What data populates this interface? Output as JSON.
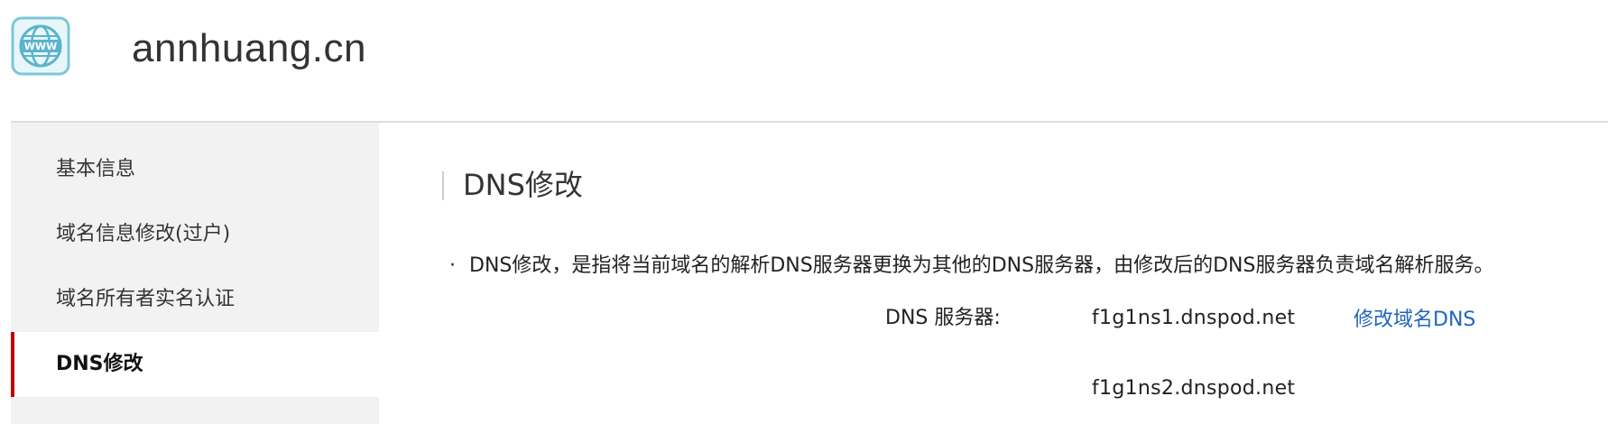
{
  "header": {
    "logo_icon": "www-globe-icon",
    "domain": "annhuang.cn"
  },
  "sidebar": {
    "items": [
      {
        "label": "基本信息",
        "active": false
      },
      {
        "label": "域名信息修改(过户)",
        "active": false
      },
      {
        "label": "域名所有者实名认证",
        "active": false
      },
      {
        "label": "DNS修改",
        "active": true
      }
    ],
    "active_color": "#c00000"
  },
  "main": {
    "title": "DNS修改",
    "description": "DNS修改，是指将当前域名的解析DNS服务器更换为其他的DNS服务器，由修改后的DNS服务器负责域名解析服务。",
    "dns_label": "DNS 服务器:",
    "dns_servers": [
      "f1g1ns1.dnspod.net",
      "f1g1ns2.dnspod.net"
    ],
    "modify_link": "修改域名DNS",
    "link_color": "#2266bb"
  }
}
